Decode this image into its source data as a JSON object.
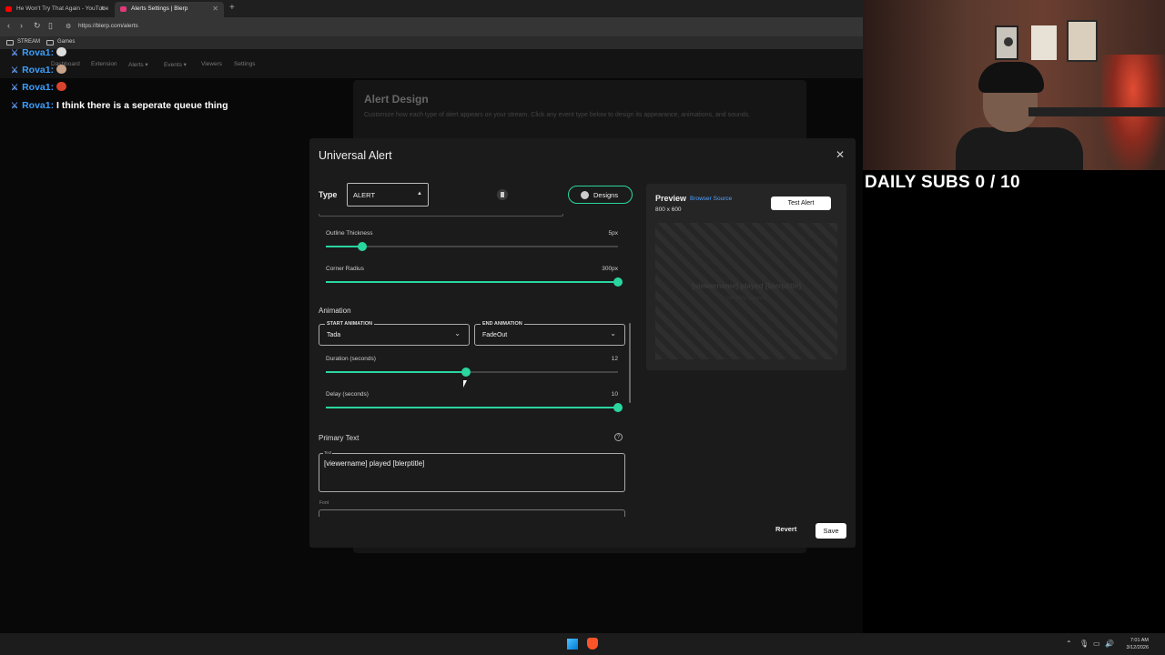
{
  "browser": {
    "tabs": [
      {
        "label": "He Won't Try That Again - YouTube",
        "active": false
      },
      {
        "label": "Alerts Settings | Blerp",
        "active": true
      }
    ],
    "new_tab": "+",
    "close_glyph": "✕",
    "url": "https://blerp.com/alerts",
    "bookmarks": [
      "STREAM",
      "Games"
    ]
  },
  "site_nav": [
    "Dashboard",
    "Extension",
    "Alerts ▾",
    "Events ▾",
    "Viewers",
    "Settings"
  ],
  "background_page": {
    "title": "Alert Design",
    "description": "Customize how each type of alert appears on your stream. Click any event type below to design its appearance, animations, and sounds."
  },
  "chat": [
    {
      "user": "Rova1:",
      "message": ""
    },
    {
      "user": "Rova1:",
      "message": ""
    },
    {
      "user": "Rova1:",
      "message": ""
    },
    {
      "user": "Rova1:",
      "message": "I think there is a seperate queue thing"
    }
  ],
  "colors": {
    "accent": "#2ad6a0",
    "link": "#4ea3ff"
  },
  "modal": {
    "title": "Universal Alert",
    "close_icon": "close-icon",
    "type_label": "Type",
    "type_value": "ALERT",
    "designs_label": "Designs",
    "sliders": [
      {
        "label": "Outline Thickness",
        "value_text": "5px",
        "fraction": 0.125
      },
      {
        "label": "Corner Radius",
        "value_text": "300px",
        "fraction": 1.0
      },
      {
        "label": "Duration (seconds)",
        "value_text": "12",
        "fraction": 0.48
      },
      {
        "label": "Delay (seconds)",
        "value_text": "10",
        "fraction": 1.0
      }
    ],
    "animation_label": "Animation",
    "start_animation": {
      "label": "START ANIMATION",
      "value": "Tada"
    },
    "end_animation": {
      "label": "END ANIMATION",
      "value": "FadeOut"
    },
    "primary_text_label": "Primary Text",
    "text_field_label": "Text",
    "text_field_value": "[viewername] played [blerptitle]",
    "font_label": "Font",
    "revert_label": "Revert",
    "save_label": "Save"
  },
  "preview": {
    "title": "Preview",
    "link": "Browser Source",
    "size": "800 x 600",
    "test_label": "Test Alert",
    "main_text": "[viewername] played [blerptitle]",
    "sub_text": "with Blerp (queued)"
  },
  "overlay": {
    "daily_subs": "DAILY SUBS 0 / 10"
  },
  "taskbar": {
    "time": "7:01 AM",
    "date": "3/12/2026"
  }
}
